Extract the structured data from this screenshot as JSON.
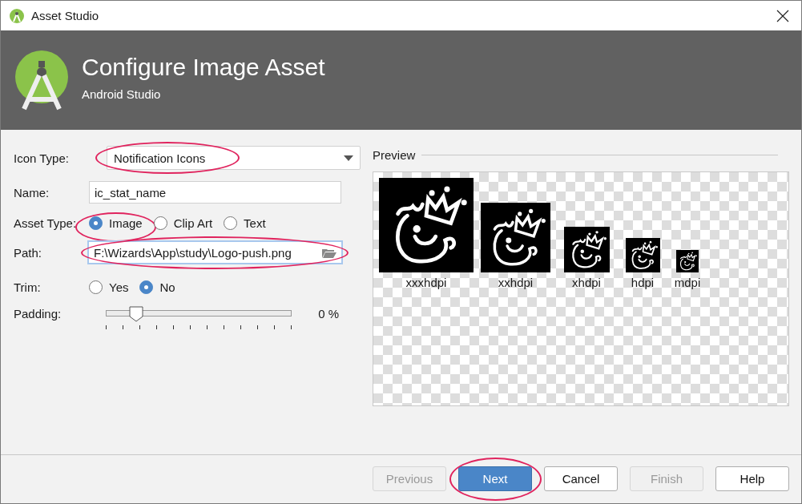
{
  "window": {
    "title": "Asset Studio"
  },
  "header": {
    "title": "Configure Image Asset",
    "subtitle": "Android Studio"
  },
  "form": {
    "icon_type": {
      "label": "Icon Type:",
      "value": "Notification Icons",
      "circled": true
    },
    "name": {
      "label": "Name:",
      "value": "ic_stat_name"
    },
    "asset_type": {
      "label": "Asset Type:",
      "options": [
        {
          "label": "Image",
          "selected": true,
          "circled": true
        },
        {
          "label": "Clip Art",
          "selected": false,
          "circled": false
        },
        {
          "label": "Text",
          "selected": false,
          "circled": false
        }
      ]
    },
    "path": {
      "label": "Path:",
      "value": "F:\\Wizards\\App\\study\\Logo-push.png",
      "focused": true,
      "circled": true
    },
    "trim": {
      "label": "Trim:",
      "options": [
        {
          "label": "Yes",
          "selected": false
        },
        {
          "label": "No",
          "selected": true
        }
      ]
    },
    "padding": {
      "label": "Padding:",
      "level": 0.16,
      "reading": "0 %"
    }
  },
  "preview": {
    "title": "Preview",
    "densities": [
      {
        "label": "xxxhdpi"
      },
      {
        "label": "xxhdpi"
      },
      {
        "label": "xhdpi"
      },
      {
        "label": "hdpi"
      },
      {
        "label": "mdpi"
      }
    ]
  },
  "buttons": [
    {
      "label": "Previous",
      "disabled": true,
      "default": false,
      "circled": false
    },
    {
      "label": "Next",
      "disabled": false,
      "default": true,
      "circled": true
    },
    {
      "label": "Cancel",
      "disabled": false,
      "default": false,
      "circled": false
    },
    {
      "label": "Finish",
      "disabled": true,
      "default": false,
      "circled": false
    },
    {
      "label": "Help",
      "disabled": false,
      "default": false,
      "circled": false
    }
  ]
}
